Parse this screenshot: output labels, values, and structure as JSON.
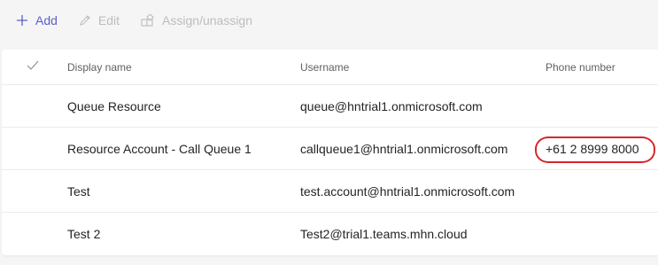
{
  "toolbar": {
    "add_label": "Add",
    "edit_label": "Edit",
    "assign_label": "Assign/unassign",
    "accent_color": "#5b5fc7",
    "disabled_color": "#bdbdbd"
  },
  "table": {
    "columns": {
      "select_icon": "checkmark-icon",
      "display_name": "Display name",
      "username": "Username",
      "phone_number": "Phone number"
    },
    "rows": [
      {
        "display_name": "Queue Resource",
        "username": "queue@hntrial1.onmicrosoft.com",
        "phone_number": ""
      },
      {
        "display_name": "Resource Account - Call Queue 1",
        "username": "callqueue1@hntrial1.onmicrosoft.com",
        "phone_number": "+61 2 8999 8000",
        "highlighted": true,
        "highlight_color": "#d7262b"
      },
      {
        "display_name": "Test",
        "username": "test.account@hntrial1.onmicrosoft.com",
        "phone_number": ""
      },
      {
        "display_name": "Test 2",
        "username": "Test2@trial1.teams.mhn.cloud",
        "phone_number": ""
      }
    ]
  }
}
